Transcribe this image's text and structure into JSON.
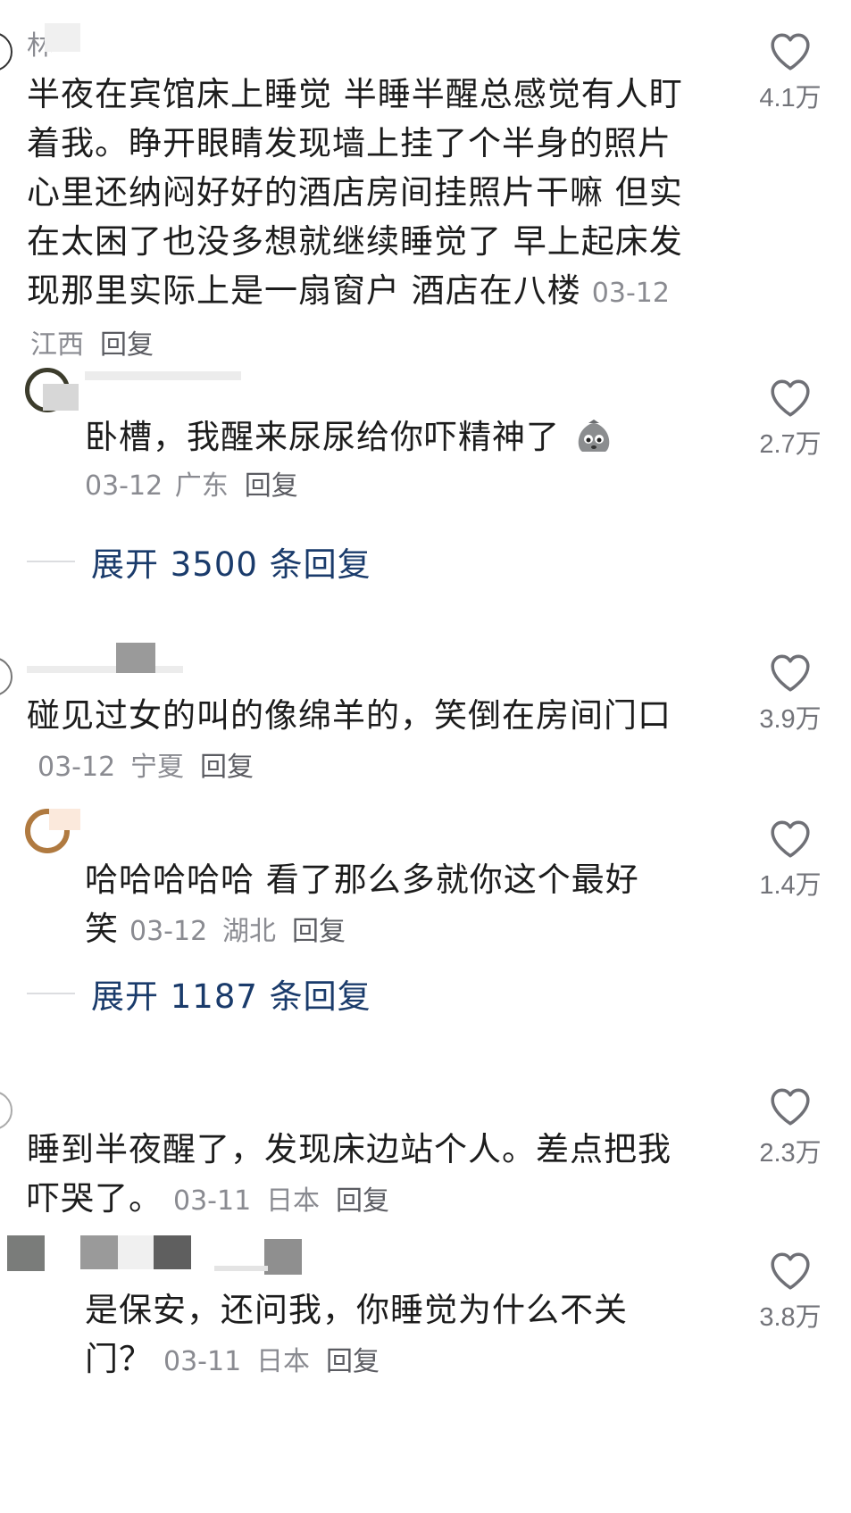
{
  "comments": [
    {
      "name": "林",
      "text": "半夜在宾馆床上睡觉 半睡半醒总感觉有人盯着我。睁开眼睛发现墙上挂了个半身的照片 心里还纳闷好好的酒店房间挂照片干嘛 但实在太困了也没多想就继续睡觉了 早上起床发现那里实际上是一扇窗户 酒店在八楼",
      "date": "03-12",
      "location": "江西",
      "reply": "回复",
      "likes": "4.1万",
      "replies": [
        {
          "text": "卧槽，我醒来尿尿给你吓精神了",
          "date": "03-12",
          "location": "广东",
          "reply": "回复",
          "likes": "2.7万"
        }
      ],
      "expand": "展开 3500 条回复"
    },
    {
      "name": "",
      "text": "碰见过女的叫的像绵羊的，笑倒在房间门口",
      "date": "03-12",
      "location": "宁夏",
      "reply": "回复",
      "likes": "3.9万",
      "replies": [
        {
          "text": "哈哈哈哈哈 看了那么多就你这个最好笑",
          "date": "03-12",
          "location": "湖北",
          "reply": "回复",
          "likes": "1.4万"
        }
      ],
      "expand": "展开 1187 条回复"
    },
    {
      "name": "",
      "text": "睡到半夜醒了，发现床边站个人。差点把我吓哭了。",
      "date": "03-11",
      "location": "日本",
      "reply": "回复",
      "likes": "2.3万",
      "replies": [
        {
          "text": "是保安，还问我，你睡觉为什么不关门？",
          "date": "03-11",
          "location": "日本",
          "reply": "回复",
          "likes": "3.8万"
        }
      ]
    }
  ],
  "icons": {
    "like": "heart-outline-icon",
    "emoji": "crying-pouch-emoji-icon"
  },
  "colors": {
    "expand_link": "#1a3b6b",
    "meta": "#8a8b91",
    "text": "#1c1c1c"
  }
}
